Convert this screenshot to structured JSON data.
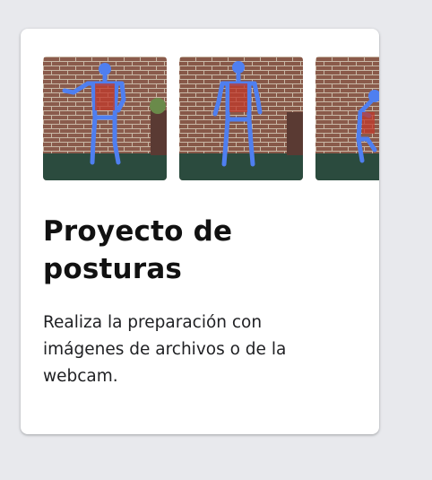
{
  "card": {
    "title": "Proyecto de posturas",
    "description": "Realiza la preparación con imágenes de archivos o de la webcam."
  },
  "thumbnails": [
    {
      "name": "pose-sample-1"
    },
    {
      "name": "pose-sample-2"
    },
    {
      "name": "pose-sample-3"
    }
  ],
  "colors": {
    "background": "#e8e9ed",
    "card": "#ffffff",
    "skeleton": "#4f7ff0",
    "brick": "#8a5a4a",
    "floor": "#2b4b3e"
  }
}
